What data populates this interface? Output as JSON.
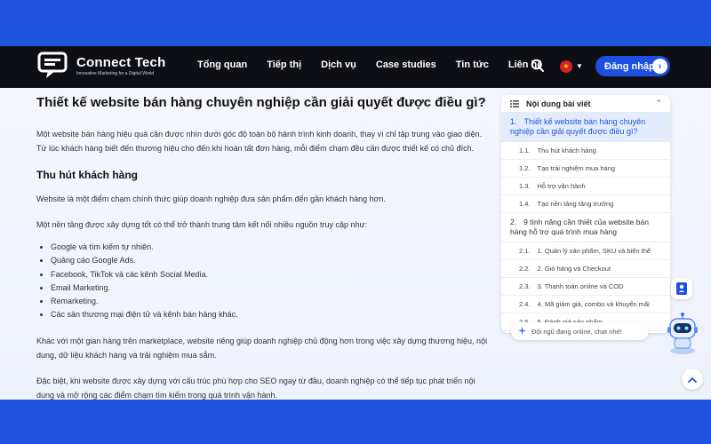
{
  "nav": {
    "logo_name": "Connect Tech",
    "logo_tagline": "Innovative Marketing for a Digital World",
    "menu": [
      "Tổng quan",
      "Tiếp thị",
      "Dịch vụ",
      "Case studies",
      "Tin tức",
      "Liên hệ"
    ],
    "login_label": "Đăng nhập",
    "flag_symbol": "★"
  },
  "article": {
    "heading": "Thiết kế website bán hàng chuyên nghiệp cần giải quyết được điều gì?",
    "intro": "Một website bán hàng hiệu quả cần được nhìn dưới góc độ toàn bộ hành trình kinh doanh, thay vì chỉ tập trung vào giao diện. Từ lúc khách hàng biết đến thương hiệu cho đến khi hoàn tất đơn hàng, mỗi điểm chạm đều cần được thiết kế có chủ đích.",
    "subheading": "Thu hút khách hàng",
    "para1": "Website là một điểm chạm chính thức giúp doanh nghiệp đưa sản phẩm đến gần khách hàng hơn.",
    "para2": "Một nền tảng được xây dựng tốt có thể trở thành trung tâm kết nối nhiều nguồn truy cập như:",
    "bullets": [
      "Google và tìm kiếm tự nhiên.",
      "Quảng cáo Google Ads.",
      "Facebook, TikTok và các kênh Social Media.",
      "Email Marketing.",
      "Remarketing.",
      "Các sàn thương mại điện tử và kênh bán hàng khác."
    ],
    "para3": "Khác với một gian hàng trên marketplace, website riêng giúp doanh nghiệp chủ động hơn trong việc xây dựng thương hiệu, nội dung, dữ liệu khách hàng và trải nghiệm mua sắm.",
    "para4": "Đặc biệt, khi website được xây dựng với cấu trúc phù hợp cho SEO ngay từ đầu, doanh nghiệp có thể tiếp tục phát triển nội dung và mở rộng các điểm chạm tìm kiếm trong quá trình vận hành."
  },
  "toc": {
    "title": "Nội dung bài viết",
    "section1": {
      "num": "1.",
      "label": "Thiết kế website bán hàng chuyên nghiệp cần giải quyết được điều gì?"
    },
    "section1_items": [
      {
        "num": "1.1.",
        "label": "Thu hút khách hàng"
      },
      {
        "num": "1.2.",
        "label": "Tạo trải nghiệm mua hàng"
      },
      {
        "num": "1.3.",
        "label": "Hỗ trợ vận hành"
      },
      {
        "num": "1.4.",
        "label": "Tạo nền tảng tăng trưởng"
      }
    ],
    "section2": {
      "num": "2.",
      "label": "9 tính năng cần thiết của website bán hàng hỗ trợ quá trình mua hàng"
    },
    "section2_items": [
      {
        "num": "2.1.",
        "label": "1. Quản lý sản phẩm, SKU và biến thể"
      },
      {
        "num": "2.2.",
        "label": "2. Giỏ hàng và Checkout"
      },
      {
        "num": "2.3.",
        "label": "3. Thanh toán online và COD"
      },
      {
        "num": "2.4.",
        "label": "4. Mã giảm giá, combo và khuyến mãi"
      },
      {
        "num": "2.5.",
        "label": "5. Đánh giá sản phẩm"
      }
    ]
  },
  "chat": {
    "placeholder": "Đội ngũ đang online, chat nhé!"
  },
  "colors": {
    "brand": "#1d4fe0",
    "nav_bg": "#0e0f14",
    "toc_active": "#1e57d8"
  },
  "icons": [
    "logo-chat-icon",
    "search-icon",
    "vietnam-flag-icon",
    "chevron-down-icon",
    "arrow-right-icon",
    "list-icon",
    "chevron-up-icon",
    "sparkle-icon",
    "contact-book-icon",
    "robot-assistant-icon",
    "scroll-top-icon"
  ]
}
